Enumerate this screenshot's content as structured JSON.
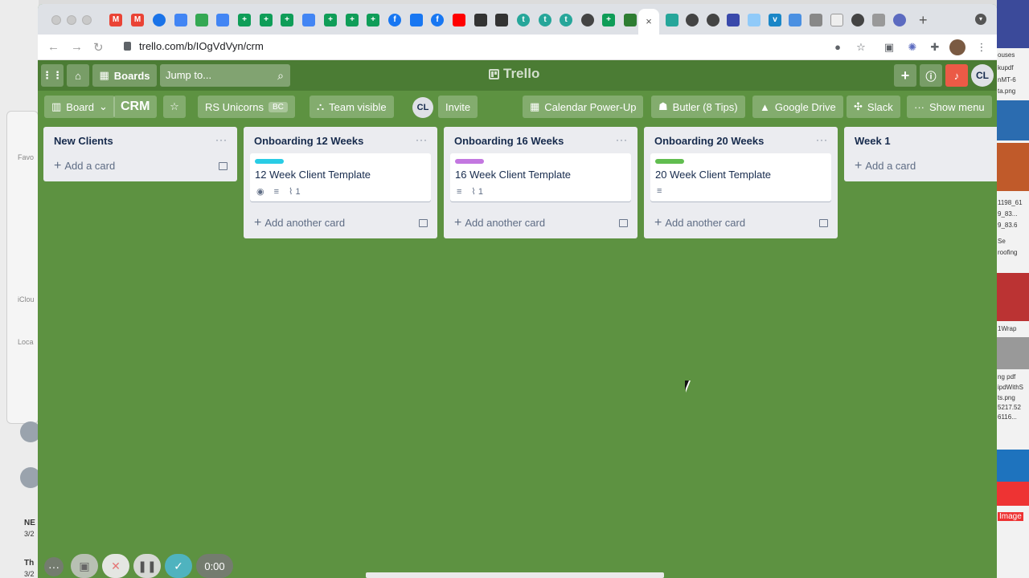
{
  "desktop_left": {
    "sidebar_labels": [
      "Favo",
      "iClou",
      "Loca"
    ],
    "notes": [
      {
        "title": "NE",
        "date": "3/2"
      },
      {
        "title": "Th",
        "date": "3/2"
      }
    ]
  },
  "desktop_right": {
    "snippets": [
      "ouses",
      "1198_61",
      "9_83...",
      "Se",
      "kupdf",
      "nMT-6",
      "ta.png",
      "9_83.6",
      "roofing",
      "1Wrap",
      "ng pdf",
      "ipdWithS",
      "ts.png",
      "5217.52",
      "6116...",
      "Image"
    ]
  },
  "browser": {
    "url": "trello.com/b/IOgVdVyn/crm",
    "colors": {
      "board_bg": "#5d9241",
      "header_bg": "#4b7c34"
    }
  },
  "trello_header": {
    "boards_label": "Boards",
    "search_placeholder": "Jump to...",
    "logo_text": "Trello",
    "user_initials": "CL"
  },
  "board_bar": {
    "view_label": "Board",
    "board_name": "CRM",
    "workspace_label": "RS Unicorns",
    "workspace_badge": "BC",
    "visibility_label": "Team visible",
    "member_initials": "CL",
    "invite_label": "Invite",
    "calendar_label": "Calendar Power-Up",
    "butler_label": "Butler (8 Tips)",
    "drive_label": "Google Drive",
    "slack_label": "Slack",
    "menu_label": "Show menu"
  },
  "lists": [
    {
      "title": "New Clients",
      "add_label": "Add a card"
    },
    {
      "title": "Onboarding 12 Weeks",
      "add_label": "Add another card",
      "card": {
        "title": "12 Week Client Template",
        "label_color": "#29cce5",
        "attachments": "1"
      }
    },
    {
      "title": "Onboarding 16 Weeks",
      "add_label": "Add another card",
      "card": {
        "title": "16 Week Client Template",
        "label_color": "#c377e0",
        "attachments": "1"
      }
    },
    {
      "title": "Onboarding 20 Weeks",
      "add_label": "Add another card",
      "card": {
        "title": "20 Week Client Template",
        "label_color": "#61bd4f"
      }
    },
    {
      "title": "Week 1",
      "add_label": "Add a card"
    }
  ],
  "recorder": {
    "timer": "0:00"
  }
}
